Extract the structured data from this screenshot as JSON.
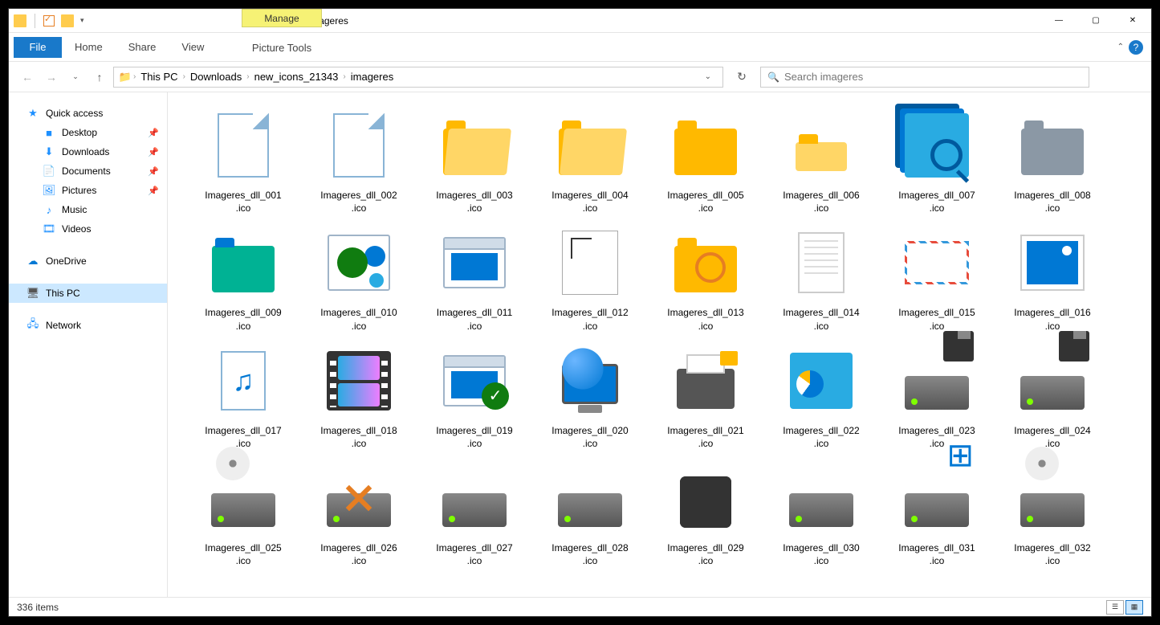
{
  "window_title": "imageres",
  "manage_tab": "Manage",
  "ribbon": {
    "file": "File",
    "tabs": [
      "Home",
      "Share",
      "View"
    ],
    "picture_tools": "Picture Tools"
  },
  "breadcrumb": [
    "This PC",
    "Downloads",
    "new_icons_21343",
    "imageres"
  ],
  "search_placeholder": "Search imageres",
  "sidebar": {
    "quick_access": "Quick access",
    "pinned": [
      {
        "label": "Desktop",
        "icon": "desktop"
      },
      {
        "label": "Downloads",
        "icon": "downloads"
      },
      {
        "label": "Documents",
        "icon": "documents"
      },
      {
        "label": "Pictures",
        "icon": "pictures"
      }
    ],
    "recent": [
      {
        "label": "Music",
        "icon": "music"
      },
      {
        "label": "Videos",
        "icon": "videos"
      }
    ],
    "onedrive": "OneDrive",
    "this_pc": "This PC",
    "network": "Network"
  },
  "files": [
    {
      "name": "Imageres_dll_001.ico",
      "type": "blank"
    },
    {
      "name": "Imageres_dll_002.ico",
      "type": "blank"
    },
    {
      "name": "Imageres_dll_003.ico",
      "type": "folder-open"
    },
    {
      "name": "Imageres_dll_004.ico",
      "type": "folder-open"
    },
    {
      "name": "Imageres_dll_005.ico",
      "type": "folder"
    },
    {
      "name": "Imageres_dll_006.ico",
      "type": "folder-small"
    },
    {
      "name": "Imageres_dll_007.ico",
      "type": "search-stack"
    },
    {
      "name": "Imageres_dll_008.ico",
      "type": "folder-gray"
    },
    {
      "name": "Imageres_dll_009.ico",
      "type": "folder-teal"
    },
    {
      "name": "Imageres_dll_010.ico",
      "type": "balls"
    },
    {
      "name": "Imageres_dll_011.ico",
      "type": "app"
    },
    {
      "name": "Imageres_dll_012.ico",
      "type": "empty-doc"
    },
    {
      "name": "Imageres_dll_013.ico",
      "type": "folder-mag"
    },
    {
      "name": "Imageres_dll_014.ico",
      "type": "note"
    },
    {
      "name": "Imageres_dll_015.ico",
      "type": "mail"
    },
    {
      "name": "Imageres_dll_016.ico",
      "type": "photo"
    },
    {
      "name": "Imageres_dll_017.ico",
      "type": "music"
    },
    {
      "name": "Imageres_dll_018.ico",
      "type": "video"
    },
    {
      "name": "Imageres_dll_019.ico",
      "type": "app-check"
    },
    {
      "name": "Imageres_dll_020.ico",
      "type": "globe-monitor"
    },
    {
      "name": "Imageres_dll_021.ico",
      "type": "printer"
    },
    {
      "name": "Imageres_dll_022.ico",
      "type": "panel"
    },
    {
      "name": "Imageres_dll_023.ico",
      "type": "drive-floppy"
    },
    {
      "name": "Imageres_dll_024.ico",
      "type": "drive-floppy"
    },
    {
      "name": "Imageres_dll_025.ico",
      "type": "drive-disc"
    },
    {
      "name": "Imageres_dll_026.ico",
      "type": "drive-x"
    },
    {
      "name": "Imageres_dll_027.ico",
      "type": "drive"
    },
    {
      "name": "Imageres_dll_028.ico",
      "type": "drive"
    },
    {
      "name": "Imageres_dll_029.ico",
      "type": "chip"
    },
    {
      "name": "Imageres_dll_030.ico",
      "type": "drive"
    },
    {
      "name": "Imageres_dll_031.ico",
      "type": "drive-win"
    },
    {
      "name": "Imageres_dll_032.ico",
      "type": "drive-disc"
    }
  ],
  "status": "336 items"
}
